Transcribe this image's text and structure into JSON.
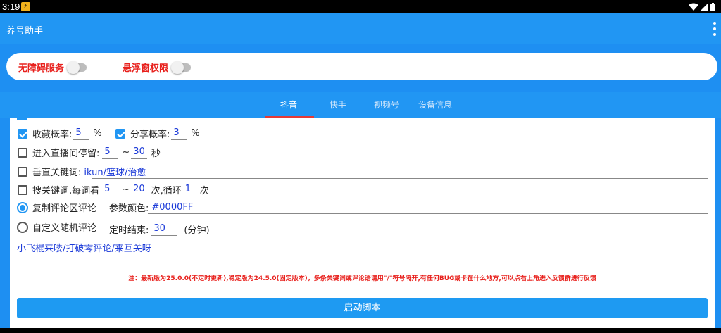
{
  "status_bar": {
    "time": "3:19",
    "notification_icon": "app-notification-icon"
  },
  "app_bar": {
    "title": "养号助手",
    "menu_icon": "more-vert-icon"
  },
  "permissions": {
    "accessibility_label": "无障碍服务",
    "overlay_label": "悬浮窗权限"
  },
  "tabs": [
    {
      "label": "抖音",
      "active": true
    },
    {
      "label": "快手",
      "active": false
    },
    {
      "label": "视频号",
      "active": false
    },
    {
      "label": "设备信息",
      "active": false
    }
  ],
  "settings": {
    "favorite_label": "收藏概率:",
    "favorite_value": "5",
    "favorite_unit": "%",
    "favorite_checked": true,
    "share_label": "分享概率:",
    "share_value": "3",
    "share_unit": "%",
    "share_checked": true,
    "live_label": "进入直播间停留:",
    "live_min": "5",
    "live_sep": "~",
    "live_max": "30",
    "live_unit": "秒",
    "live_checked": false,
    "vertical_label": "垂直关键词:",
    "vertical_value": "ikun/篮球/治愈",
    "vertical_checked": false,
    "search_label": "搜关键词,每词看",
    "search_min": "5",
    "search_sep": "~",
    "search_max": "20",
    "search_loop_label": "次,循环",
    "search_loop_value": "1",
    "search_loop_unit": "次",
    "search_checked": false,
    "copy_comment_label": "复制评论区评论",
    "copy_comment_selected": true,
    "param_color_label": "参数颜色:",
    "param_color_value": "#0000FF",
    "custom_comment_label": "自定义随机评论",
    "custom_comment_selected": false,
    "timer_label": "定时结束:",
    "timer_value": "30",
    "timer_unit": "(分钟)",
    "comment_text": "小飞棍来喽/打破零评论/来互关呀"
  },
  "notice": "注：最新版为25.0.0(不定时更新),稳定版为24.5.0(固定版本)，多条关键词或评论语请用\"/\"符号隔开,有任何BUG或卡在什么地方,可以点右上角进入反馈群进行反馈",
  "start_button": "启动脚本",
  "colors": {
    "primary": "#2196f3",
    "accent_red": "#e8201c",
    "value_blue": "#1a39d8"
  }
}
